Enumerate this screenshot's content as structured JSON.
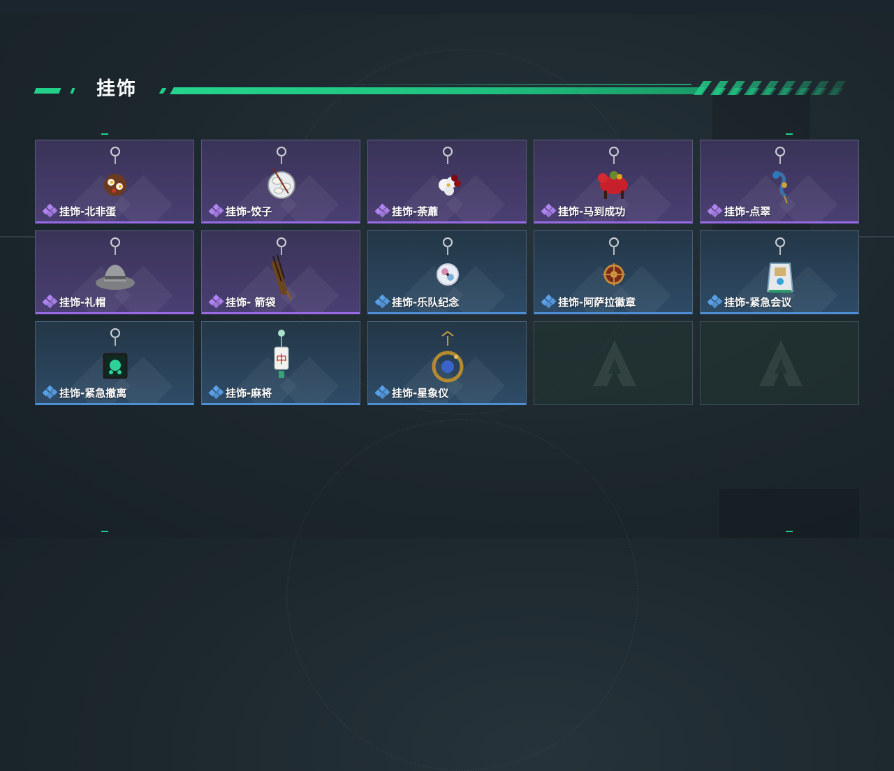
{
  "section": {
    "title": "挂饰"
  },
  "colors": {
    "accent": "#22d08a",
    "epic": "#9a6ae6",
    "rare": "#4f8fd6"
  },
  "items": [
    {
      "name": "挂饰-北非蛋",
      "rarity": "epic",
      "icon": "shakshuka-charm-icon"
    },
    {
      "name": "挂饰-饺子",
      "rarity": "epic",
      "icon": "dumpling-plate-charm-icon"
    },
    {
      "name": "挂饰-荼蘼",
      "rarity": "epic",
      "icon": "flower-charm-icon"
    },
    {
      "name": "挂饰-马到成功",
      "rarity": "epic",
      "icon": "red-horse-charm-icon"
    },
    {
      "name": "挂饰-点翠",
      "rarity": "epic",
      "icon": "hairpin-charm-icon"
    },
    {
      "name": "挂饰-礼帽",
      "rarity": "epic",
      "icon": "fedora-hat-charm-icon"
    },
    {
      "name": "挂饰- 箭袋",
      "rarity": "epic",
      "icon": "quiver-charm-icon"
    },
    {
      "name": "挂饰-乐队纪念",
      "rarity": "rare",
      "icon": "band-badge-charm-icon"
    },
    {
      "name": "挂饰-阿萨拉徽章",
      "rarity": "rare",
      "icon": "asala-emblem-charm-icon"
    },
    {
      "name": "挂饰-紧急会议",
      "rarity": "rare",
      "icon": "emergency-meeting-charm-icon"
    },
    {
      "name": "挂饰-紧急撤离",
      "rarity": "rare",
      "icon": "emergency-evac-charm-icon"
    },
    {
      "name": "挂饰-麻将",
      "rarity": "rare",
      "icon": "mahjong-tile-charm-icon"
    },
    {
      "name": "挂饰-星象仪",
      "rarity": "rare",
      "icon": "astrolabe-charm-icon"
    },
    {
      "name": "",
      "rarity": "empty",
      "icon": "game-logo-icon"
    },
    {
      "name": "",
      "rarity": "empty",
      "icon": "game-logo-icon"
    }
  ]
}
